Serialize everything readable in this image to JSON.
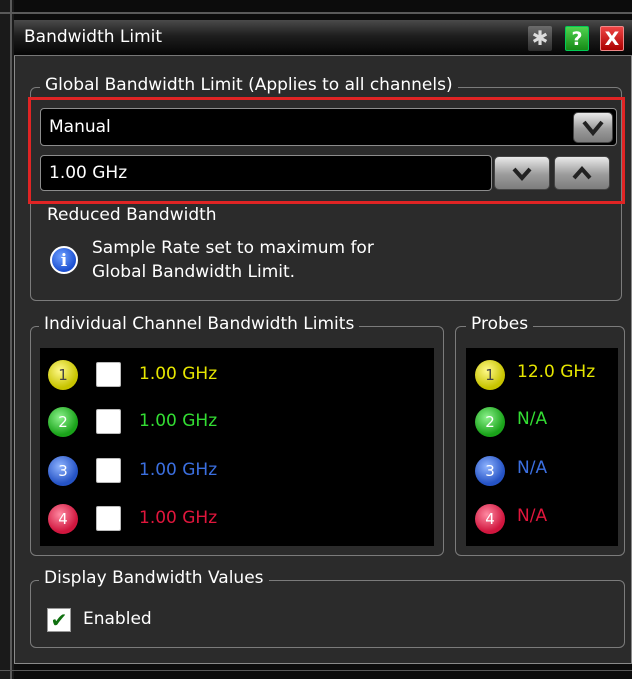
{
  "dialog": {
    "title": "Bandwidth Limit",
    "buttons": {
      "settings": "gear-icon",
      "help": "?",
      "close": "X"
    }
  },
  "global": {
    "group_label": "Global Bandwidth Limit (Applies to all channels)",
    "mode_value": "Manual",
    "limit_value": "1.00 GHz",
    "reduced_label": "Reduced Bandwidth",
    "info_line1": "Sample Rate set to maximum for",
    "info_line2": "Global Bandwidth Limit."
  },
  "individual": {
    "group_label": "Individual Channel Bandwidth Limits",
    "channels": [
      {
        "num": "1",
        "value": "1.00 GHz",
        "color": "#e6e600",
        "checked": false
      },
      {
        "num": "2",
        "value": "1.00 GHz",
        "color": "#33dd33",
        "checked": false
      },
      {
        "num": "3",
        "value": "1.00 GHz",
        "color": "#3b6fe0",
        "checked": false
      },
      {
        "num": "4",
        "value": "1.00 GHz",
        "color": "#e0163c",
        "checked": false
      }
    ]
  },
  "probes": {
    "group_label": "Probes",
    "items": [
      {
        "num": "1",
        "value": "12.0 GHz",
        "color": "#e6e600"
      },
      {
        "num": "2",
        "value": "N/A",
        "color": "#33dd33"
      },
      {
        "num": "3",
        "value": "N/A",
        "color": "#3b6fe0"
      },
      {
        "num": "4",
        "value": "N/A",
        "color": "#e0163c"
      }
    ]
  },
  "display": {
    "group_label": "Display Bandwidth Values",
    "enabled_label": "Enabled",
    "enabled_checked": true
  }
}
